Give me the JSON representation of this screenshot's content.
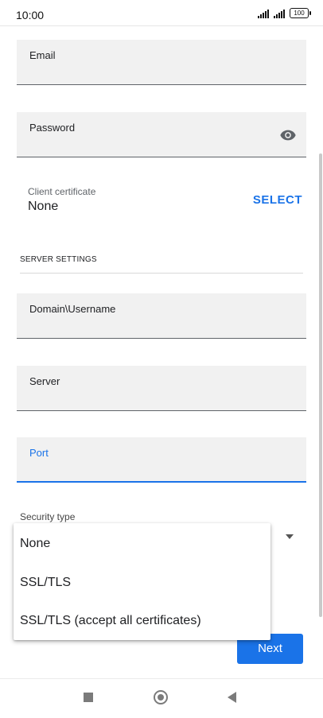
{
  "status_bar": {
    "time": "10:00",
    "battery": "100"
  },
  "form": {
    "email": {
      "label": "Email"
    },
    "password": {
      "label": "Password"
    },
    "client_certificate": {
      "label": "Client certificate",
      "value": "None",
      "action": "SELECT"
    },
    "server_settings": {
      "heading": "SERVER SETTINGS",
      "domain_username": {
        "label": "Domain\\Username"
      },
      "server": {
        "label": "Server"
      },
      "port": {
        "label": "Port"
      },
      "security_type": {
        "label": "Security type"
      }
    }
  },
  "security_dropdown": {
    "options": [
      "None",
      "SSL/TLS",
      "SSL/TLS (accept all certificates)"
    ]
  },
  "next_button": {
    "label": "Next"
  },
  "colors": {
    "accent": "#1a73e8",
    "field_bg": "#f1f1f1"
  },
  "icons": {
    "password_toggle": "eye-icon",
    "dropdown": "triangle-down-icon",
    "nav": [
      "square-recents-icon",
      "circle-home-icon",
      "triangle-back-icon"
    ]
  }
}
